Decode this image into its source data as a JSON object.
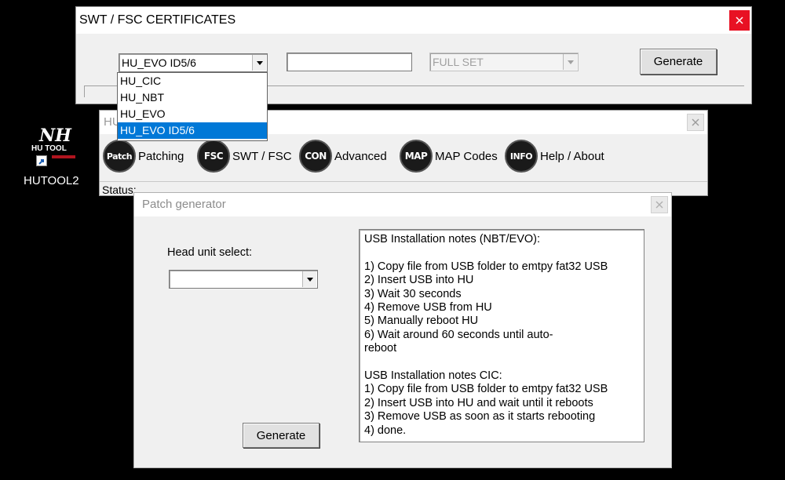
{
  "desktop": {
    "icon_logo_text": "NH",
    "icon_logo_sub": "HU TOOL",
    "icon_label": "HUTOOL2"
  },
  "hutool_window": {
    "title": "HU",
    "tools": [
      {
        "icon_text": "Patch",
        "label": "Patching"
      },
      {
        "icon_text": "FSC",
        "label": "SWT / FSC"
      },
      {
        "icon_text": "CON",
        "label": "Advanced"
      },
      {
        "icon_text": "MAP",
        "label": "MAP Codes"
      },
      {
        "icon_text": "INFO",
        "label": "Help / About"
      }
    ],
    "status_label": "Status:"
  },
  "swt_window": {
    "title": "SWT / FSC CERTIFICATES",
    "head_unit_selected": "HU_EVO ID5/6",
    "dropdown_options": [
      "HU_CIC",
      "HU_NBT",
      "HU_EVO",
      "HU_EVO ID5/6"
    ],
    "dropdown_selected_index": 3,
    "text_field_value": "",
    "set_combo_value": "FULL SET",
    "generate_label": "Generate"
  },
  "patch_window": {
    "title": "Patch generator",
    "head_unit_label": "Head unit select:",
    "head_unit_value": "",
    "generate_label": "Generate",
    "notes": "USB Installation notes (NBT/EVO):\n\n1) Copy file from USB folder to emtpy fat32 USB\n2) Insert USB into HU\n3) Wait 30 seconds\n4) Remove USB from HU\n5) Manually reboot HU\n6) Wait around 60 seconds until auto-\nreboot\n\nUSB Installation notes CIC:\n1) Copy file from USB folder to emtpy fat32 USB\n2) Insert USB into HU and wait until it reboots\n3) Remove USB as soon as it starts rebooting\n4) done."
  },
  "colors": {
    "selection": "#0078d7",
    "close_button": "#e81123"
  }
}
